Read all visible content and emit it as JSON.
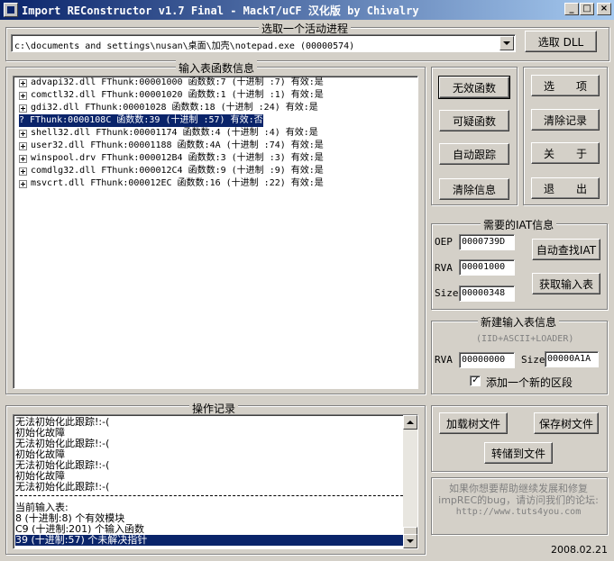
{
  "window": {
    "title": "Import REConstructor v1.7 Final - MackT/uCF 汉化版 by Chivalry",
    "minimize": "_",
    "maximize": "□",
    "close": "×"
  },
  "process": {
    "label": "选取一个活动进程",
    "path": "c:\\documents and settings\\nusan\\桌面\\加壳\\notepad.exe (00000574)",
    "pick_dll": "选取 DLL"
  },
  "imports": {
    "label": "输入表函数信息",
    "rows": [
      "advapi32.dll FThunk:00001000 函数数:7 (十进制 :7) 有效:是",
      "comctl32.dll FThunk:00001020 函数数:1 (十进制 :1) 有效:是",
      "gdi32.dll FThunk:00001028 函数数:18 (十进制 :24) 有效:是",
      "? FThunk:0000108C 函数数:39 (十进制 :57) 有效:否",
      "shell32.dll FThunk:00001174 函数数:4 (十进制 :4) 有效:是",
      "user32.dll FThunk:00001188 函数数:4A (十进制 :74) 有效:是",
      "winspool.drv FThunk:000012B4 函数数:3 (十进制 :3) 有效:是",
      "comdlg32.dll FThunk:000012C4 函数数:9 (十进制 :9) 有效:是",
      "msvcrt.dll FThunk:000012EC 函数数:16 (十进制 :22) 有效:是"
    ],
    "q_mark": "?"
  },
  "buttons": {
    "invalid": "无效函数",
    "suspect": "可疑函数",
    "auto_trace": "自动跟踪",
    "clear_info": "清除信息",
    "options": "选　　项",
    "clear_log": "清除记录",
    "about": "关　　于",
    "exit": "退　　出",
    "iat_autosearch": "自动查找IAT",
    "get_imports": "获取输入表",
    "load_tree": "加载树文件",
    "save_tree": "保存树文件",
    "fix_dump": "转储到文件"
  },
  "iat": {
    "label": "需要的IAT信息",
    "oep_label": "OEP",
    "oep": "0000739D",
    "rva_label": "RVA",
    "rva": "00001000",
    "size_label": "Size",
    "size": "00000348"
  },
  "new_import": {
    "label": "新建输入表信息",
    "hint": "(IID+ASCII+LOADER)",
    "rva_label": "RVA",
    "rva": "00000000",
    "size_label": "Size",
    "size": "00000A1A",
    "add_section": "添加一个新的区段"
  },
  "log": {
    "label": "操作记录",
    "lines": [
      "无法初始化此跟踪!:-(",
      "初始化故障",
      "无法初始化此跟踪!:-(",
      "初始化故障",
      "无法初始化此跟踪!:-(",
      "初始化故障",
      "无法初始化此跟踪!:-("
    ],
    "summary": [
      "当前输入表:",
      "8 (十进制:8) 个有效模块",
      "C9 (十进制:201) 个输入函数",
      "39 (十进制:57) 个未解决指针"
    ]
  },
  "help": {
    "line1": "如果你想要帮助继续发展和修复",
    "line2": "impREC的bug，请访问我们的论坛:",
    "line3": "http://www.tuts4you.com"
  },
  "date": "2008.02.21"
}
